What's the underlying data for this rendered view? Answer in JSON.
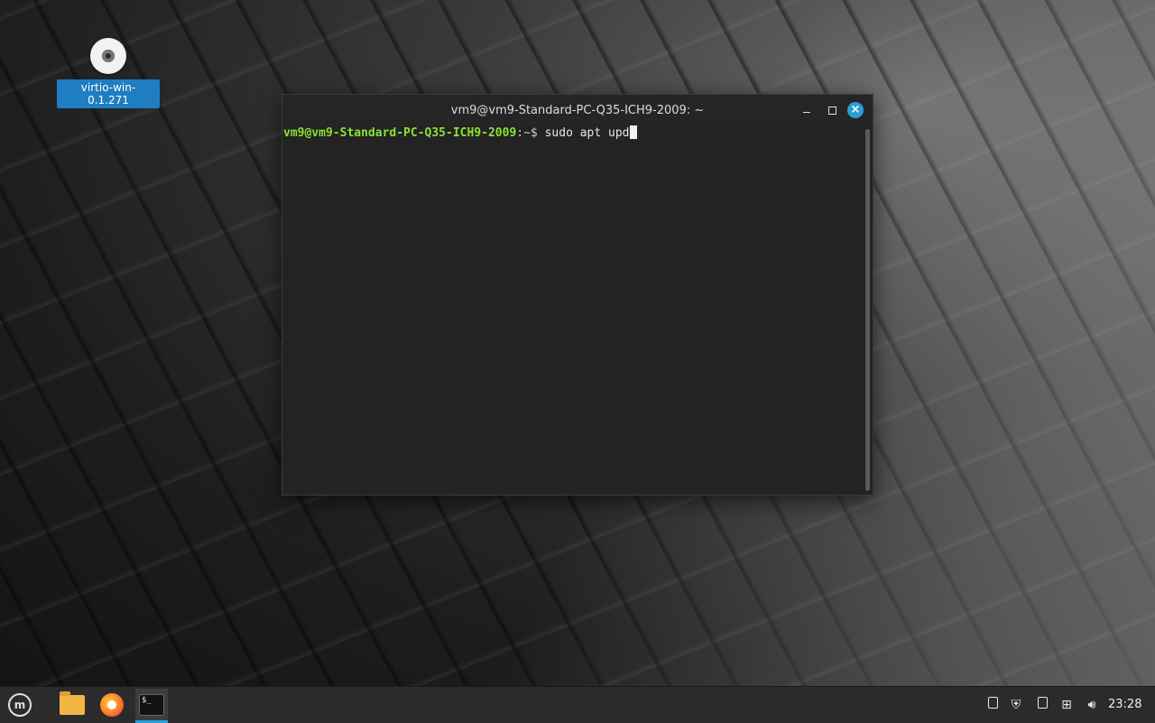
{
  "desktop": {
    "icon_label": "virtio-win-0.1.271"
  },
  "terminal": {
    "title": "vm9@vm9-Standard-PC-Q35-ICH9-2009: ~",
    "prompt_user": "vm9@vm9-Standard-PC-Q35-ICH9-2009",
    "prompt_sep": ":~$ ",
    "command": "sudo apt upd",
    "buttons": {
      "minimize": "minimize-icon",
      "maximize": "maximize-icon",
      "close": "close-icon"
    }
  },
  "taskbar": {
    "clock": "23:28",
    "launchers": [
      "menu-icon",
      "files-icon",
      "firefox-icon",
      "terminal-icon"
    ],
    "terminal_icon_text": "$_",
    "tray": [
      "update-manager-icon",
      "shield-icon",
      "notes-icon",
      "network-icon",
      "volume-icon"
    ]
  },
  "colors": {
    "prompt_user": "#8ae234",
    "accent": "#2c9ed6",
    "folder": "#f2b544"
  }
}
